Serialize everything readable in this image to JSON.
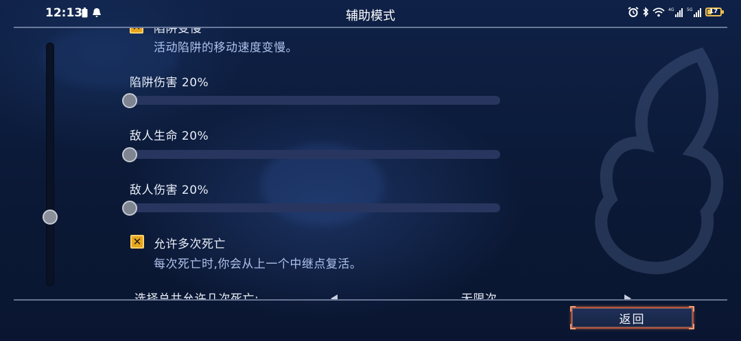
{
  "status_bar": {
    "time": "12:13",
    "title": "辅助模式",
    "battery_level": "17"
  },
  "settings": {
    "trap_slow": {
      "label": "陷阱变慢",
      "description": "活动陷阱的移动速度变慢。",
      "checked": true
    },
    "trap_damage": {
      "label": "陷阱伤害",
      "value": "20%",
      "level": 0.2
    },
    "enemy_health": {
      "label": "敌人生命",
      "value": "20%",
      "level": 0.2
    },
    "enemy_damage": {
      "label": "敌人伤害",
      "value": "20%",
      "level": 0.2
    },
    "multiple_deaths": {
      "label": "允许多次死亡",
      "description": "每次死亡时,你会从上一个中继点复活。",
      "checked": true
    },
    "death_count": {
      "label": "选择总共允许几次死亡:",
      "value": "无限次"
    }
  },
  "footer": {
    "back_label": "返回"
  },
  "colors": {
    "background": "#0d1b3a",
    "slider_track": "#28365f",
    "checkbox": "#e8a51f",
    "back_border": "#b5553c",
    "description_text": "#aec2ec"
  },
  "icons": [
    "alarm-icon",
    "bluetooth-icon",
    "wifi-icon",
    "signal-icon",
    "battery-icon",
    "notification-icon",
    "checkbox-x-icon",
    "arrow-left-icon",
    "arrow-right-icon"
  ]
}
